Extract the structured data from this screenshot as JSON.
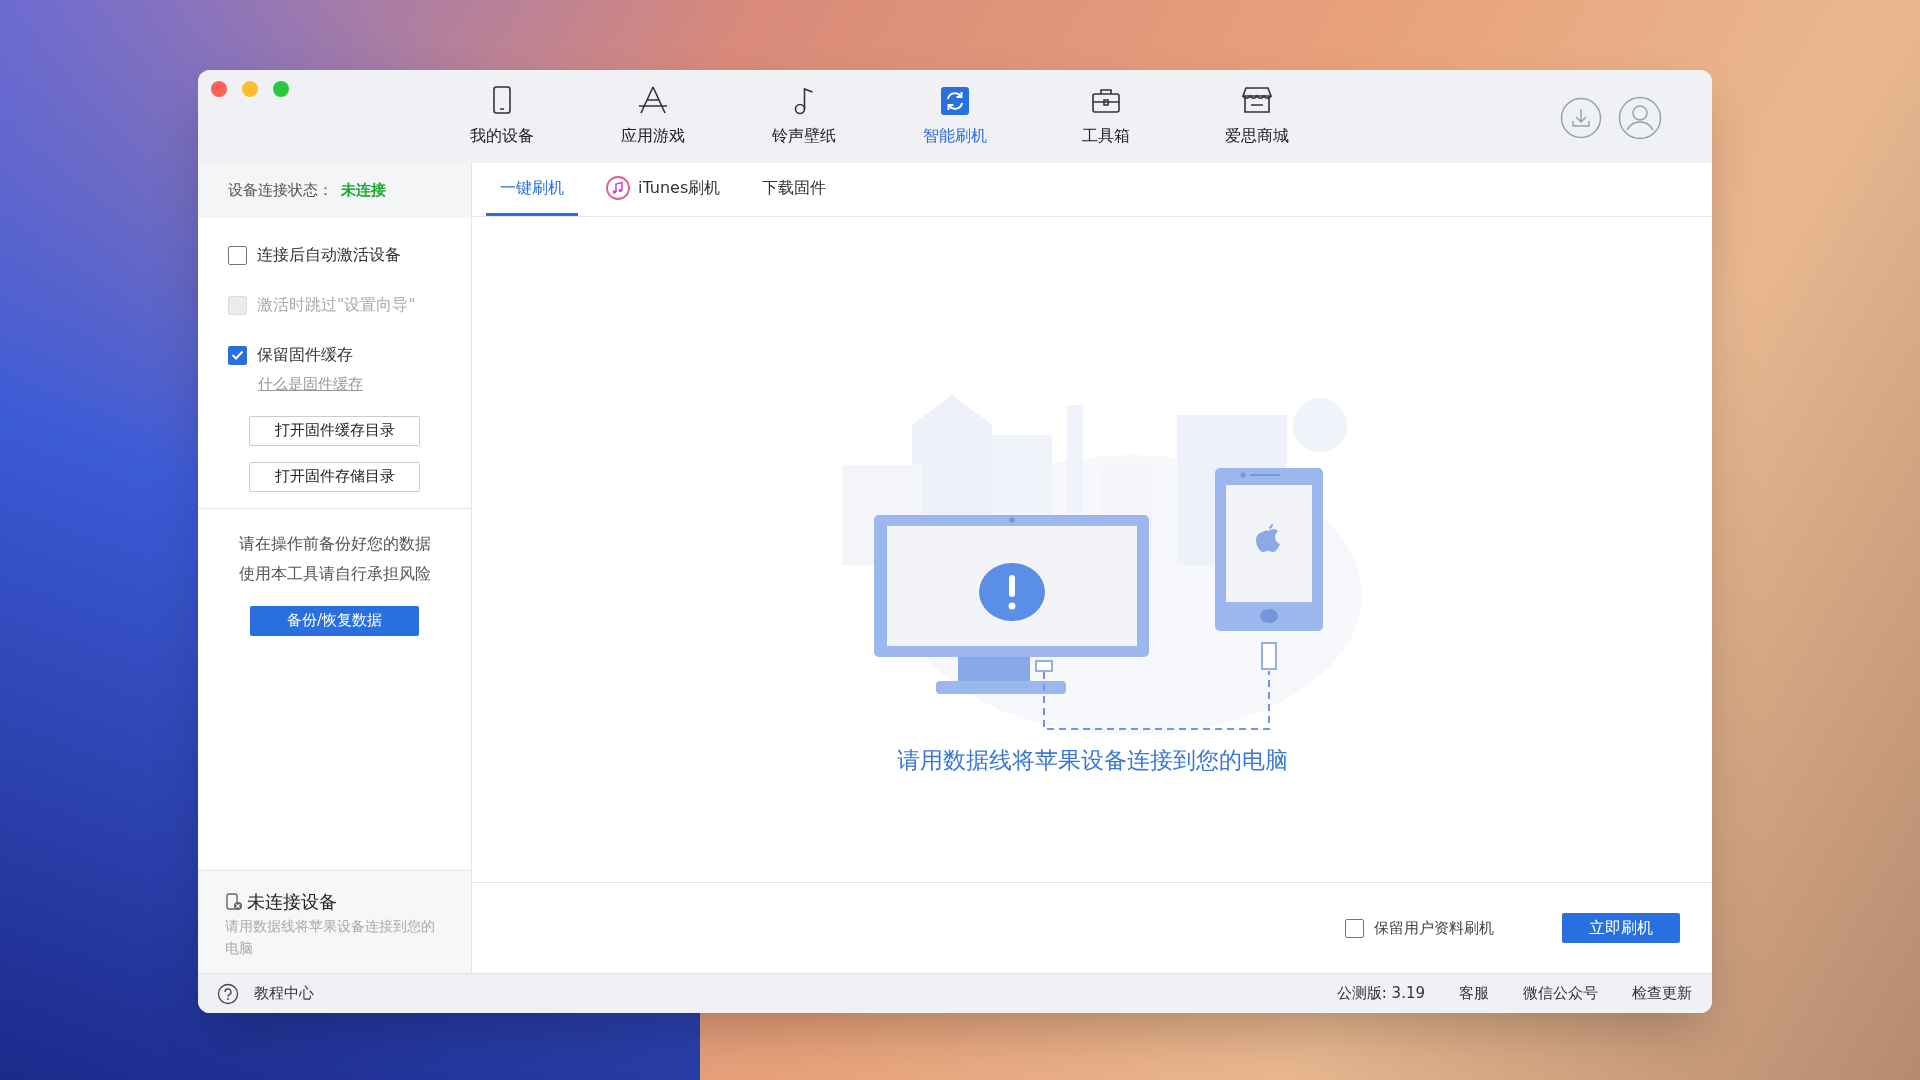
{
  "toolbar": {
    "items": [
      {
        "label": "我的设备",
        "kind": "tablet",
        "selected": false
      },
      {
        "label": "应用游戏",
        "kind": "apps",
        "selected": false
      },
      {
        "label": "铃声壁纸",
        "kind": "music",
        "selected": false
      },
      {
        "label": "智能刷机",
        "kind": "flash",
        "selected": true
      },
      {
        "label": "工具箱",
        "kind": "toolbox",
        "selected": false
      },
      {
        "label": "爱思商城",
        "kind": "store",
        "selected": false
      }
    ]
  },
  "sidebar": {
    "status_label": "设备连接状态：",
    "status_value": "未连接",
    "options": [
      {
        "label": "连接后自动激活设备",
        "checked": false,
        "disabled": false
      },
      {
        "label": "激活时跳过\"设置向导\"",
        "checked": false,
        "disabled": true
      },
      {
        "label": "保留固件缓存",
        "checked": true,
        "disabled": false
      }
    ],
    "help_link": "什么是固件缓存",
    "folder_buttons": [
      "打开固件缓存目录",
      "打开固件存储目录"
    ],
    "notice": [
      "请在操作前备份好您的数据",
      "使用本工具请自行承担风险"
    ],
    "backup_button": "备份/恢复数据",
    "device_panel": {
      "title": "未连接设备",
      "message": "请用数据线将苹果设备连接到您的电脑"
    }
  },
  "tabs": [
    {
      "label": "一键刷机",
      "kind": "plain",
      "selected": true
    },
    {
      "label": "iTunes刷机",
      "kind": "itunes",
      "selected": false
    },
    {
      "label": "下载固件",
      "kind": "plain",
      "selected": false
    }
  ],
  "main": {
    "message": "请用数据线将苹果设备连接到您的电脑"
  },
  "action_bar": {
    "keep_data": {
      "label": "保留用户资料刷机",
      "checked": false
    },
    "flash_button": "立即刷机"
  },
  "status_bar": {
    "help": "教程中心",
    "version": "公测版: 3.19",
    "links": [
      "客服",
      "微信公众号",
      "检查更新"
    ]
  }
}
